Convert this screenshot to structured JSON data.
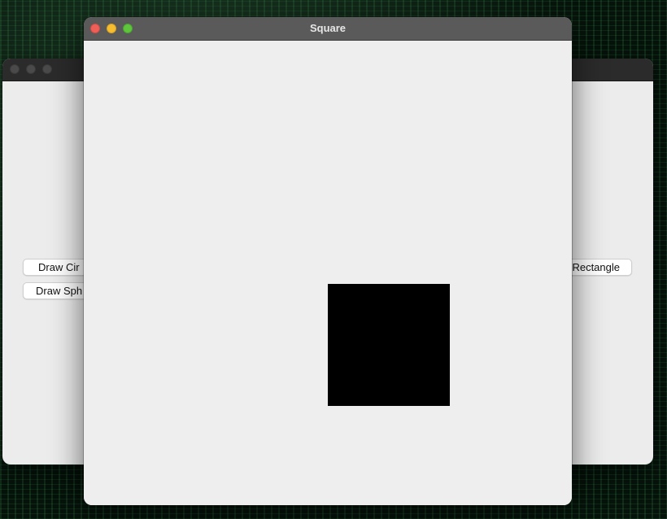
{
  "background_window": {
    "buttons": {
      "draw_circle": "Draw Cir",
      "draw_sphere": "Draw Sph",
      "draw_rectangle": "Rectangle"
    }
  },
  "front_window": {
    "title": "Square"
  },
  "colors": {
    "square_fill": "#000000",
    "close": "#ee5f57",
    "minimize": "#f5bd2f",
    "maximize": "#5ec53c"
  }
}
